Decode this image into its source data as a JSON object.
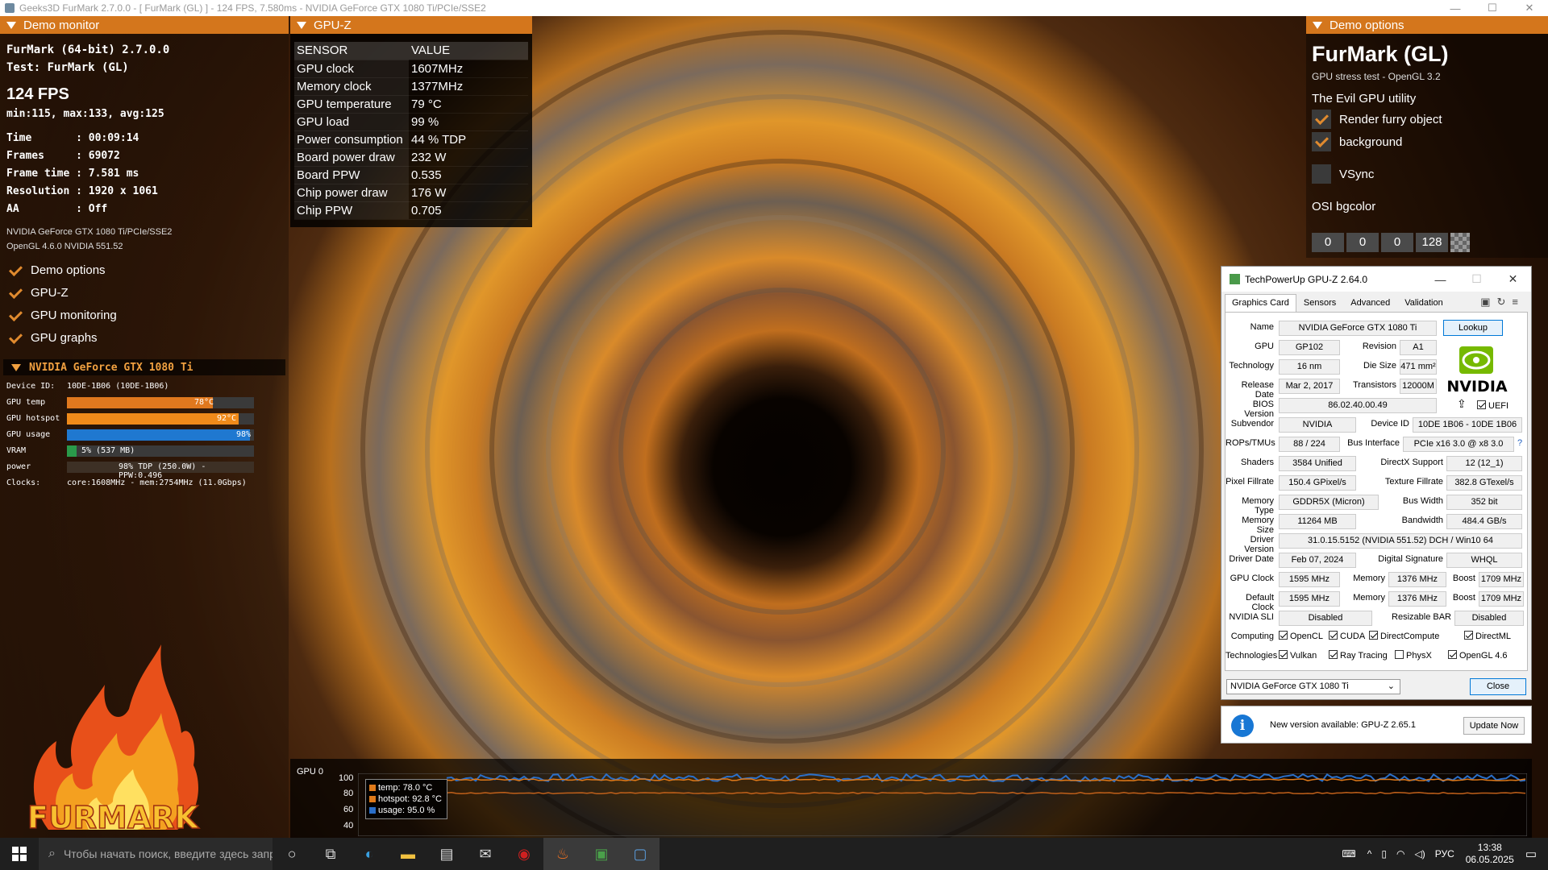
{
  "titlebar": {
    "title": "Geeks3D FurMark 2.7.0.0 - [ FurMark (GL) ] - 124 FPS, 7.580ms - NVIDIA GeForce GTX 1080 Ti/PCIe/SSE2",
    "minimize": "—",
    "maximize": "☐",
    "close": "✕"
  },
  "demo_monitor": {
    "header": "Demo monitor",
    "app": "FurMark (64-bit) 2.7.0.0",
    "test": "Test: FurMark (GL)",
    "fps": "124 FPS",
    "fps_stats": "min:115, max:133, avg:125",
    "time": "Time       : 00:09:14",
    "frames": "Frames     : 69072",
    "frame_time": "Frame time : 7.581 ms",
    "resolution": "Resolution : 1920 x 1061",
    "aa": "AA         : Off",
    "renderer": "NVIDIA GeForce GTX 1080 Ti/PCIe/SSE2",
    "opengl": "OpenGL 4.6.0 NVIDIA 551.52",
    "checks": [
      "Demo options",
      "GPU-Z",
      "GPU monitoring",
      "GPU graphs"
    ],
    "gpu_header": "NVIDIA GeForce GTX 1080 Ti",
    "device_id_label": "Device ID:",
    "device_id_value": "10DE-1B06 (10DE-1B06)",
    "gpu_temp_label": "GPU temp",
    "gpu_temp_value": "78°C",
    "gpu_temp_fraction": 0.78,
    "gpu_hotspot_label": "GPU hotspot",
    "gpu_hotspot_value": "92°C",
    "gpu_hotspot_fraction": 0.92,
    "gpu_usage_label": "GPU usage",
    "gpu_usage_value": "98%",
    "gpu_usage_fraction": 0.98,
    "vram_label": "VRAM",
    "vram_value": "5% (537 MB)",
    "vram_fraction": 0.05,
    "power_label": "power",
    "power_value": "98% TDP (250.0W) - PPW:0.496",
    "clocks_label": "Clocks:",
    "clocks_value": "core:1608MHz - mem:2754MHz (11.0Gbps)"
  },
  "logo_text": "FURMARK",
  "gpuz_overlay": {
    "header": "GPU-Z",
    "col_sensor": "SENSOR",
    "col_value": "VALUE",
    "rows": [
      {
        "k": "GPU clock",
        "v": "1607MHz"
      },
      {
        "k": "Memory clock",
        "v": "1377MHz"
      },
      {
        "k": "GPU temperature",
        "v": "79 °C"
      },
      {
        "k": "GPU load",
        "v": "99 %"
      },
      {
        "k": "Power consumption",
        "v": "44 % TDP"
      },
      {
        "k": "Board power draw",
        "v": "232 W"
      },
      {
        "k": "Board PPW",
        "v": "0.535"
      },
      {
        "k": "Chip power draw",
        "v": "176 W"
      },
      {
        "k": "Chip PPW",
        "v": "0.705"
      }
    ]
  },
  "demo_options": {
    "header": "Demo options",
    "title": "FurMark (GL)",
    "subtitle": "GPU stress test - OpenGL 3.2",
    "utility": "The Evil GPU utility",
    "render_furry": "Render furry object",
    "background": "background",
    "vsync": "VSync",
    "osi": "OSI bgcolor",
    "osi_values": [
      "0",
      "0",
      "0",
      "128"
    ]
  },
  "gpuz_window": {
    "title": "TechPowerUp GPU-Z 2.64.0",
    "tabs": [
      "Graphics Card",
      "Sensors",
      "Advanced",
      "Validation"
    ],
    "lookup": "Lookup",
    "nvidia": "NVIDIA",
    "name_label": "Name",
    "name": "NVIDIA GeForce GTX 1080 Ti",
    "gpu_label": "GPU",
    "gpu": "GP102",
    "revision_label": "Revision",
    "revision": "A1",
    "technology_label": "Technology",
    "technology": "16 nm",
    "die_size_label": "Die Size",
    "die_size": "471 mm²",
    "release_label": "Release Date",
    "release": "Mar 2, 2017",
    "transistors_label": "Transistors",
    "transistors": "12000M",
    "bios_label": "BIOS Version",
    "bios": "86.02.40.00.49",
    "uefi": "UEFI",
    "subvendor_label": "Subvendor",
    "subvendor": "NVIDIA",
    "device_id_label": "Device ID",
    "device_id": "10DE 1B06 - 10DE 1B06",
    "rops_label": "ROPs/TMUs",
    "rops": "88 / 224",
    "bus_label": "Bus Interface",
    "bus": "PCIe x16 3.0 @ x8 3.0",
    "help": "?",
    "shaders_label": "Shaders",
    "shaders": "3584 Unified",
    "directx_label": "DirectX Support",
    "directx": "12 (12_1)",
    "pixel_label": "Pixel Fillrate",
    "pixel": "150.4 GPixel/s",
    "texture_label": "Texture Fillrate",
    "texture": "382.8 GTexel/s",
    "memtype_label": "Memory Type",
    "memtype": "GDDR5X (Micron)",
    "buswidth_label": "Bus Width",
    "buswidth": "352 bit",
    "memsize_label": "Memory Size",
    "memsize": "11264 MB",
    "bandwidth_label": "Bandwidth",
    "bandwidth": "484.4 GB/s",
    "driver_label": "Driver Version",
    "driver": "31.0.15.5152 (NVIDIA 551.52) DCH / Win10 64",
    "driverdate_label": "Driver Date",
    "driverdate": "Feb 07, 2024",
    "digsig_label": "Digital Signature",
    "digsig": "WHQL",
    "gpuclock_label": "GPU Clock",
    "gpuclock": "1595 MHz",
    "memory_label": "Memory",
    "memory": "1376 MHz",
    "boost_label": "Boost",
    "boost": "1709 MHz",
    "defclock_label": "Default Clock",
    "defclock": "1595 MHz",
    "defmemory": "1376 MHz",
    "defboost": "1709 MHz",
    "sli_label": "NVIDIA SLI",
    "sli": "Disabled",
    "rebar_label": "Resizable BAR",
    "rebar": "Disabled",
    "computing_label": "Computing",
    "computing": [
      "OpenCL",
      "CUDA",
      "DirectCompute",
      "DirectML"
    ],
    "technologies_label": "Technologies",
    "technologies": [
      "Vulkan",
      "Ray Tracing",
      "PhysX",
      "OpenGL 4.6"
    ],
    "selected_gpu": "NVIDIA GeForce GTX 1080 Ti",
    "close": "Close"
  },
  "update": {
    "icon": "i",
    "text": "New version available: GPU-Z 2.65.1",
    "button": "Update Now"
  },
  "graph": {
    "label": "GPU 0",
    "ticks": [
      "100",
      "80",
      "60",
      "40"
    ],
    "legend": [
      {
        "name": "temp: 78.0 °C",
        "color": "#e07a1a"
      },
      {
        "name": "hotspot: 92.8 °C",
        "color": "#e07a1a"
      },
      {
        "name": "usage: 95.0 %",
        "color": "#2a6fc9"
      }
    ]
  },
  "taskbar": {
    "search_placeholder": "Чтобы начать поиск, введите здесь запрос",
    "lang": "РУС",
    "time": "13:38",
    "date": "06.05.2025"
  }
}
